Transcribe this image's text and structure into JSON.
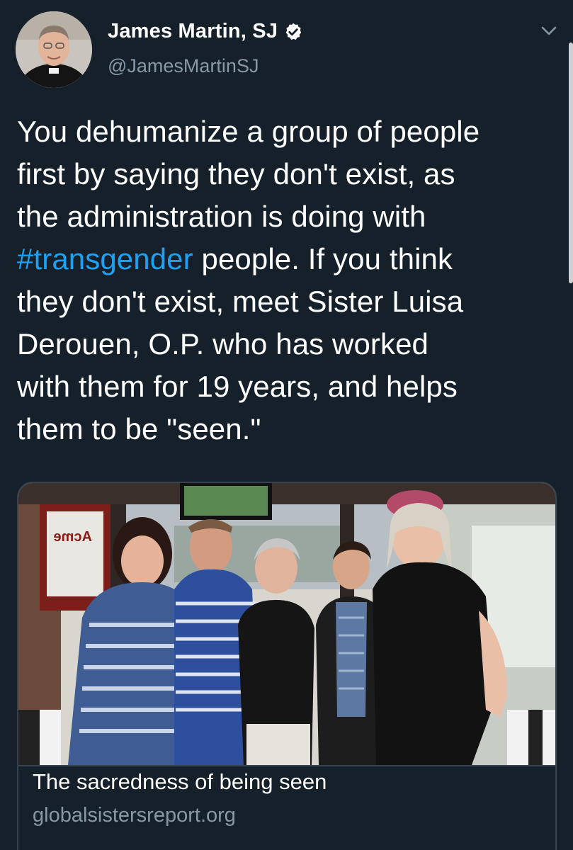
{
  "author": {
    "display_name": "James Martin, SJ",
    "handle": "@JamesMartinSJ",
    "verified": true
  },
  "tweet": {
    "line1": "You dehumanize a group of people",
    "line2": "first by saying they don't exist, as",
    "line3": "the administration is doing with",
    "hashtag": "#transgender",
    "line4_rest": " people. If you think",
    "line5": "they don't exist, meet Sister Luisa",
    "line6": "Derouen, O.P. who has worked",
    "line7": "with them for 19 years, and helps",
    "line8": "them to be \"seen.\""
  },
  "card": {
    "title": "The sacredness of being seen",
    "domain": "globalsistersreport.org",
    "image_sign_text": "Acme"
  },
  "colors": {
    "background": "#15202b",
    "link": "#1da1f2",
    "secondary_text": "#8899a6",
    "border": "#38444d",
    "verified_badge": "#ffffff"
  },
  "icons": {
    "verified": "verified-badge-icon",
    "menu": "chevron-down-icon"
  }
}
